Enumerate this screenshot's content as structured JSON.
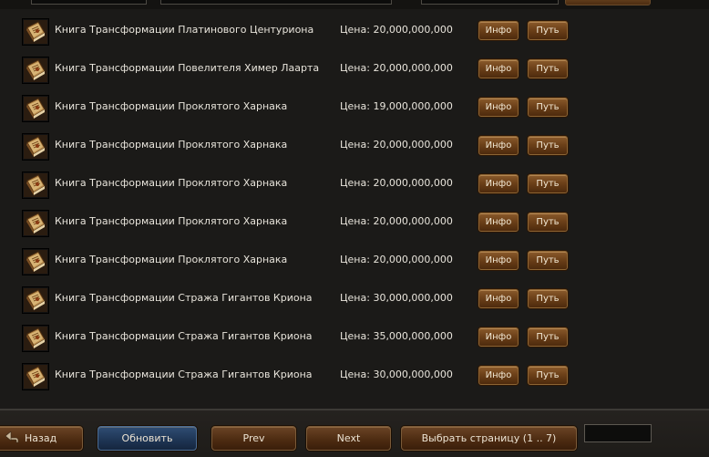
{
  "items": [
    {
      "name": "Книга Трансформации Платинового Центуриона",
      "price": "Цена: 20,000,000,000"
    },
    {
      "name": "Книга Трансформации Повелителя Химер Лаарта",
      "price": "Цена: 20,000,000,000"
    },
    {
      "name": "Книга Трансформации Проклятого Харнака",
      "price": "Цена: 19,000,000,000"
    },
    {
      "name": "Книга Трансформации Проклятого Харнака",
      "price": "Цена: 20,000,000,000"
    },
    {
      "name": "Книга Трансформации Проклятого Харнака",
      "price": "Цена: 20,000,000,000"
    },
    {
      "name": "Книга Трансформации Проклятого Харнака",
      "price": "Цена: 20,000,000,000"
    },
    {
      "name": "Книга Трансформации Проклятого Харнака",
      "price": "Цена: 20,000,000,000"
    },
    {
      "name": "Книга Трансформации Стража Гигантов Криона",
      "price": "Цена: 30,000,000,000"
    },
    {
      "name": "Книга Трансформации Стража Гигантов Криона",
      "price": "Цена: 35,000,000,000"
    },
    {
      "name": "Книга Трансформации Стража Гигантов Криона",
      "price": "Цена: 30,000,000,000"
    }
  ],
  "row_buttons": {
    "info": "Инфо",
    "path": "Путь"
  },
  "footer": {
    "back": "Назад",
    "refresh": "Обновить",
    "prev": "Prev",
    "next": "Next",
    "select_page": "Выбрать страницу (1 .. 7)",
    "page_input_value": ""
  },
  "icons": {
    "item": "spellbook-icon",
    "back": "back-arrow-icon"
  },
  "colors": {
    "button_brown": "#6d4119",
    "button_blue": "#1f3656",
    "text": "#e8e4db",
    "background": "#1b1a18"
  }
}
